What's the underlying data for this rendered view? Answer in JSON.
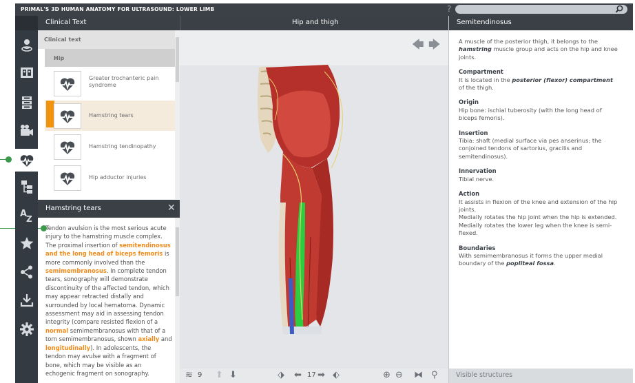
{
  "app_title": "PRIMAL'S 3D HUMAN ANATOMY FOR ULTRASOUND: LOWER LIMB",
  "help_label": "?",
  "search": {
    "placeholder": ""
  },
  "panels": {
    "left": "Clinical Text",
    "center": "Hip and thigh",
    "right": "Semitendinosus"
  },
  "sidebar": [
    {
      "name": "rotate-model-icon"
    },
    {
      "name": "views-icon"
    },
    {
      "name": "layers-stack-icon"
    },
    {
      "name": "video-camera-icon"
    },
    {
      "name": "clinical-heart-icon",
      "active": true
    },
    {
      "name": "hierarchy-tree-icon"
    },
    {
      "name": "a-z-index-icon"
    },
    {
      "name": "favorites-star-icon"
    },
    {
      "name": "share-icon"
    },
    {
      "name": "download-icon"
    },
    {
      "name": "settings-gear-icon"
    }
  ],
  "list": {
    "category": "Clinical text",
    "subcategory": "Hip",
    "items": [
      {
        "label": "Greater trochanteric pain syndrome"
      },
      {
        "label": "Hamstring tears",
        "selected": true
      },
      {
        "label": "Hamstring tendinopathy"
      },
      {
        "label": "Hip adductor injuries"
      }
    ]
  },
  "detail": {
    "title": "Hamstring tears",
    "close": "✕",
    "t1": "Tendon avulsion is the most serious acute injury to the hamstring muscle complex. The proximal insertion of ",
    "h1": "semitendinosus and the long head of biceps femoris",
    "t2": " is more commonly involved than the ",
    "h2": "semimembranosus",
    "t3": ". In complete tendon tears, sonography will demonstrate discontinuity of the affected tendon, which may appear retracted distally and surrounded by local hematoma. Dynamic assessment may aid in assessing tendon integrity (compare resisted flexion of a ",
    "h3": "normal",
    "t4": " semimembranosus with that of a torn semimembranosus, shown ",
    "h4": "axially",
    "t5": " and ",
    "h5": "longitudinally",
    "t6": "). In adolescents, the tendon may avulse with a fragment of bone, which may be visible as an echogenic fragment on sonography."
  },
  "viewer": {
    "layers_count": "9",
    "view_number": "17",
    "back_arrow": "🡄",
    "forward_arrow": "🡆"
  },
  "info": {
    "intro_a": "A muscle of the posterior thigh, it belongs to the ",
    "intro_b": "hamstring",
    "intro_c": " muscle group and acts on the hip and knee joints.",
    "compartment_h": "Compartment",
    "compartment_a": "It is located in the ",
    "compartment_b": "posterior (flexor) compartment",
    "compartment_c": " of the thigh.",
    "origin_h": "Origin",
    "origin": "Hip bone: ischial tuberosity (with the long head of biceps femoris).",
    "insertion_h": "Insertion",
    "insertion": "Tibia: shaft (medial surface via pes anserinus; the conjoined tendons of sartorius, gracilis and semitendinosus).",
    "innervation_h": "Innervation",
    "innervation": "Tibial nerve.",
    "action_h": "Action",
    "action1": "It assists in flexion of the knee and extension of the hip joints.",
    "action2": "Medially rotates the hip joint when the hip is extended.",
    "action3": "Medially rotates the lower leg when the knee is semi-flexed.",
    "boundaries_h": "Boundaries",
    "boundaries_a": "With semimembranosus it forms the upper medial boundary of the ",
    "boundaries_b": "popliteal fossa",
    "boundaries_c": "."
  },
  "visible_structures": "Visible structures",
  "colors": {
    "accent": "#f0930f",
    "header": "#3b4047",
    "sidebar": "#343a41",
    "pin": "#3a9a4a",
    "muscle": "#c0392b",
    "highlight": "#2ecc40"
  }
}
